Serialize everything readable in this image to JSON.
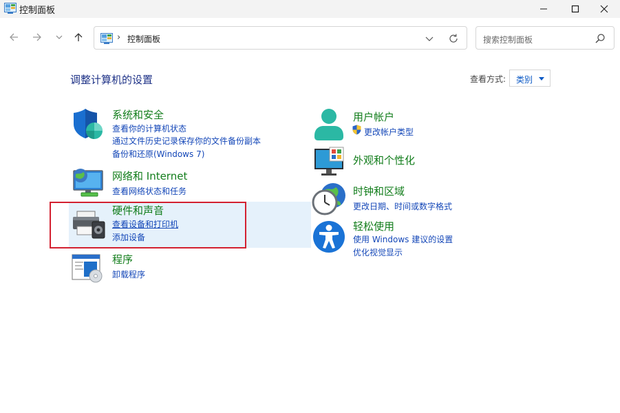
{
  "window": {
    "title": "控制面板"
  },
  "nav": {
    "address_text": "控制面板",
    "address_separator": "›",
    "search_placeholder": "搜索控制面板"
  },
  "header": {
    "title": "调整计算机的设置",
    "view_by_label": "查看方式:",
    "view_by_value": "类别"
  },
  "categories": [
    {
      "icon": "shield-icon",
      "title": "系统和安全",
      "links": [
        "查看你的计算机状态",
        "通过文件历史记录保存你的文件备份副本",
        "备份和还原(Windows 7)"
      ]
    },
    {
      "icon": "network-icon",
      "title": "网络和 Internet",
      "links": [
        "查看网络状态和任务"
      ]
    },
    {
      "icon": "printer-icon",
      "title": "硬件和声音",
      "links": [
        "查看设备和打印机",
        "添加设备"
      ]
    },
    {
      "icon": "programs-icon",
      "title": "程序",
      "links": [
        "卸载程序"
      ]
    },
    {
      "icon": "user-icon",
      "title": "用户帐户",
      "links": [
        "更改帐户类型"
      ]
    },
    {
      "icon": "monitor-palette-icon",
      "title": "外观和个性化",
      "links": []
    },
    {
      "icon": "clock-globe-icon",
      "title": "时钟和区域",
      "links": [
        "更改日期、时间或数字格式"
      ]
    },
    {
      "icon": "accessibility-icon",
      "title": "轻松使用",
      "links": [
        "使用 Windows 建议的设置",
        "优化视觉显示"
      ]
    }
  ],
  "colors": {
    "category_title": "#127d1b",
    "link": "#1447b8",
    "heading": "#1e3287",
    "highlight": "#d32030"
  }
}
